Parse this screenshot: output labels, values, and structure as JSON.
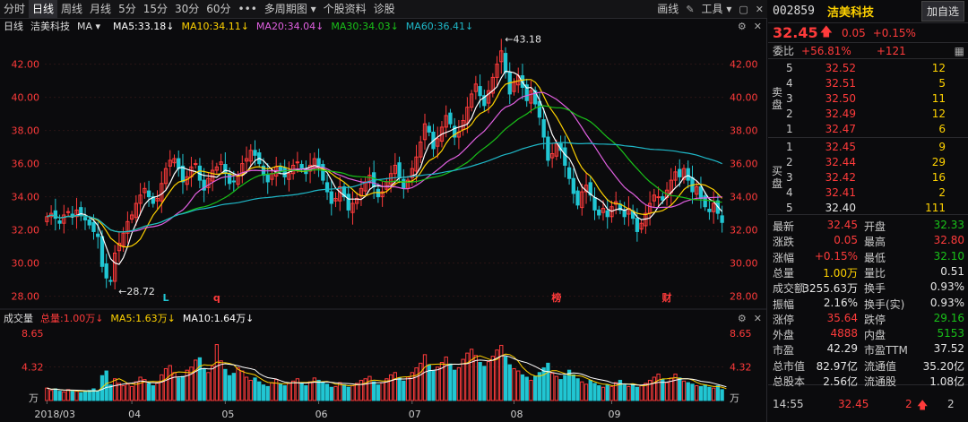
{
  "toolbar": {
    "tabs": [
      {
        "label": "分时"
      },
      {
        "label": "日线",
        "active": true
      },
      {
        "label": "周线"
      },
      {
        "label": "月线"
      },
      {
        "label": "5分"
      },
      {
        "label": "15分"
      },
      {
        "label": "30分"
      },
      {
        "label": "60分"
      },
      {
        "label": "•••"
      },
      {
        "label": "多周期图 ▾"
      },
      {
        "label": "个股资料"
      },
      {
        "label": "诊股"
      }
    ],
    "draw": "画线",
    "tools": "工具 ▾"
  },
  "ma_bar": {
    "period": "日线",
    "name": "洁美科技",
    "indicator": "MA ▾",
    "ma5": "MA5:33.18↓",
    "ma10": "MA10:34.11↓",
    "ma20": "MA20:34.04↓",
    "ma30": "MA30:34.03↓",
    "ma60": "MA60:36.41↓"
  },
  "vol_header": {
    "title": "成交量",
    "total": "总量:1.00万↓",
    "ma5": "MA5:1.63万↓",
    "ma10": "MA10:1.64万↓"
  },
  "colors": {
    "up": "#ff3b3b",
    "down": "#21c6d3",
    "ma5": "#ffffff",
    "ma10": "#ffd200",
    "ma20": "#e060e0",
    "ma30": "#19c219",
    "ma60": "#1fb8c8",
    "grid": "#2a1515"
  },
  "chart_data": {
    "type": "candlestick",
    "x_labels": [
      "2018/03",
      "04",
      "05",
      "06",
      "07",
      "08",
      "09"
    ],
    "y_ticks": [
      28.0,
      30.0,
      32.0,
      34.0,
      36.0,
      38.0,
      40.0,
      42.0
    ],
    "ylim": [
      27.6,
      43.6
    ],
    "annotations": {
      "high": "←43.18",
      "low": "←28.72",
      "marks": [
        "L",
        "q",
        "榜",
        "财"
      ]
    },
    "close": [
      32.8,
      33.0,
      32.7,
      32.4,
      32.9,
      33.1,
      32.8,
      33.2,
      32.9,
      32.6,
      32.3,
      31.9,
      31.6,
      29.8,
      29.1,
      28.9,
      30.6,
      31.2,
      31.8,
      32.5,
      32.9,
      33.6,
      34.1,
      34.5,
      34.0,
      33.6,
      33.9,
      34.8,
      35.7,
      36.2,
      36.3,
      35.7,
      34.9,
      35.2,
      35.8,
      36.0,
      35.0,
      34.4,
      35.1,
      35.6,
      35.8,
      36.1,
      35.4,
      34.8,
      34.9,
      35.3,
      36.0,
      36.3,
      36.8,
      36.5,
      36.0,
      35.3,
      34.9,
      35.4,
      35.8,
      35.6,
      35.2,
      35.4,
      35.9,
      36.1,
      35.7,
      35.4,
      35.9,
      36.3,
      35.8,
      35.0,
      34.3,
      33.6,
      33.9,
      34.6,
      34.0,
      33.2,
      33.6,
      33.9,
      34.5,
      34.9,
      35.3,
      34.6,
      34.0,
      34.3,
      34.9,
      35.4,
      35.9,
      35.2,
      34.5,
      35.0,
      35.7,
      36.4,
      37.3,
      38.4,
      37.9,
      36.9,
      37.5,
      38.2,
      38.9,
      38.4,
      37.6,
      37.9,
      38.6,
      39.4,
      40.2,
      40.8,
      40.1,
      39.5,
      40.4,
      41.2,
      42.0,
      42.8,
      41.5,
      40.2,
      40.9,
      41.3,
      40.6,
      39.8,
      40.4,
      39.6,
      38.8,
      37.6,
      36.2,
      36.6,
      37.2,
      36.8,
      35.9,
      35.1,
      34.2,
      33.5,
      34.3,
      34.7,
      34.1,
      33.2,
      32.9,
      33.3,
      32.8,
      33.4,
      33.7,
      33.2,
      32.8,
      33.3,
      32.7,
      31.9,
      32.4,
      33.0,
      33.6,
      34.1,
      34.0,
      33.8,
      34.4,
      35.0,
      35.5,
      35.2,
      35.7,
      35.0,
      34.3,
      34.6,
      33.9,
      33.4,
      33.1,
      33.6,
      33.0,
      32.45
    ],
    "volume_ylim": [
      0,
      8.65
    ],
    "volume_ticks": [
      4.32,
      8.65
    ],
    "volume_unit": "万",
    "volume": [
      1.6,
      1.3,
      1.5,
      1.2,
      1.1,
      1.4,
      1.3,
      1.2,
      1.0,
      1.1,
      1.3,
      1.5,
      1.2,
      3.2,
      3.8,
      2.0,
      2.8,
      2.2,
      1.9,
      2.1,
      1.8,
      2.4,
      3.0,
      2.7,
      2.2,
      1.9,
      2.3,
      3.3,
      4.1,
      4.5,
      3.6,
      2.9,
      3.1,
      3.9,
      4.3,
      5.2,
      5.5,
      4.1,
      3.6,
      4.4,
      7.2,
      5.1,
      4.0,
      3.2,
      3.5,
      4.2,
      3.8,
      3.0,
      2.6,
      2.9,
      2.4,
      2.0,
      1.8,
      2.3,
      2.7,
      2.1,
      1.9,
      2.2,
      2.5,
      2.8,
      2.2,
      1.9,
      2.4,
      2.9,
      2.6,
      2.3,
      2.1,
      1.7,
      1.8,
      2.3,
      2.0,
      1.7,
      1.9,
      2.2,
      2.6,
      2.8,
      3.1,
      2.4,
      2.0,
      2.3,
      2.8,
      3.3,
      3.6,
      2.9,
      2.5,
      3.0,
      3.6,
      4.2,
      4.8,
      5.9,
      4.6,
      3.8,
      4.3,
      4.9,
      5.6,
      4.7,
      3.9,
      4.2,
      5.3,
      6.1,
      6.6,
      5.8,
      4.9,
      4.4,
      5.0,
      5.7,
      6.5,
      7.1,
      5.6,
      4.6,
      4.1,
      3.8,
      3.3,
      3.0,
      2.6,
      3.1,
      3.6,
      4.2,
      4.8,
      3.5,
      3.1,
      2.7,
      3.2,
      3.9,
      3.3,
      2.8,
      2.4,
      2.1,
      2.6,
      2.2,
      1.9,
      1.7,
      2.0,
      1.8,
      2.3,
      2.6,
      2.0,
      1.8,
      2.1,
      1.7,
      1.9,
      2.2,
      2.6,
      3.0,
      3.4,
      2.7,
      2.3,
      2.9,
      3.4,
      2.9,
      2.5,
      2.3,
      2.1,
      1.9,
      1.8,
      2.0,
      1.7,
      1.6,
      1.9,
      1.4,
      1.0
    ]
  },
  "stock": {
    "code": "002859",
    "name": "洁美科技",
    "add": "加自选",
    "price": "32.45",
    "arrow": "🡅",
    "chg": "0.05",
    "chgp": "+0.15%",
    "ratio_lbl": "委比",
    "ratio": "+56.81%",
    "diff": "+121"
  },
  "book": {
    "sell_label": "卖盘",
    "buy_label": "买盘",
    "asks": [
      {
        "lvl": "5",
        "px": "32.52",
        "vol": "12"
      },
      {
        "lvl": "4",
        "px": "32.51",
        "vol": "5"
      },
      {
        "lvl": "3",
        "px": "32.50",
        "vol": "11"
      },
      {
        "lvl": "2",
        "px": "32.49",
        "vol": "12"
      },
      {
        "lvl": "1",
        "px": "32.47",
        "vol": "6"
      }
    ],
    "bids": [
      {
        "lvl": "1",
        "px": "32.45",
        "vol": "9"
      },
      {
        "lvl": "2",
        "px": "32.44",
        "vol": "29"
      },
      {
        "lvl": "3",
        "px": "32.42",
        "vol": "16"
      },
      {
        "lvl": "4",
        "px": "32.41",
        "vol": "2"
      },
      {
        "lvl": "5",
        "px": "32.40",
        "vol": "111"
      }
    ]
  },
  "quote": [
    {
      "l1": "最新",
      "v1": "32.45",
      "c1": "red",
      "l2": "开盘",
      "v2": "32.33",
      "c2": "green"
    },
    {
      "l1": "涨跌",
      "v1": "0.05",
      "c1": "red",
      "l2": "最高",
      "v2": "32.80",
      "c2": "red"
    },
    {
      "l1": "涨幅",
      "v1": "+0.15%",
      "c1": "red",
      "l2": "最低",
      "v2": "32.10",
      "c2": "green"
    },
    {
      "l1": "总量",
      "v1": "1.00万",
      "c1": "yellow",
      "l2": "量比",
      "v2": "0.51",
      "c2": "white"
    },
    {
      "l1": "成交额",
      "v1": "3255.63万",
      "c1": "white",
      "l2": "换手",
      "v2": "0.93%",
      "c2": "white"
    },
    {
      "l1": "振幅",
      "v1": "2.16%",
      "c1": "white",
      "l2": "换手(实)",
      "v2": "0.93%",
      "c2": "white"
    },
    {
      "l1": "涨停",
      "v1": "35.64",
      "c1": "red",
      "l2": "跌停",
      "v2": "29.16",
      "c2": "green"
    },
    {
      "l1": "外盘",
      "v1": "4888",
      "c1": "red",
      "l2": "内盘",
      "v2": "5153",
      "c2": "green"
    },
    {
      "l1": "市盈",
      "v1": "42.29",
      "c1": "white",
      "l2": "市盈TTM",
      "v2": "37.52",
      "c2": "white"
    },
    {
      "l1": "总市值",
      "v1": "82.97亿",
      "c1": "white",
      "l2": "流通值",
      "v2": "35.20亿",
      "c2": "white"
    },
    {
      "l1": "总股本",
      "v1": "2.56亿",
      "c1": "white",
      "l2": "流通股",
      "v2": "1.08亿",
      "c2": "white"
    }
  ],
  "tick": {
    "time": "14:55",
    "price": "32.45",
    "vol": "2",
    "arrow": "🡅",
    "count": "2"
  }
}
